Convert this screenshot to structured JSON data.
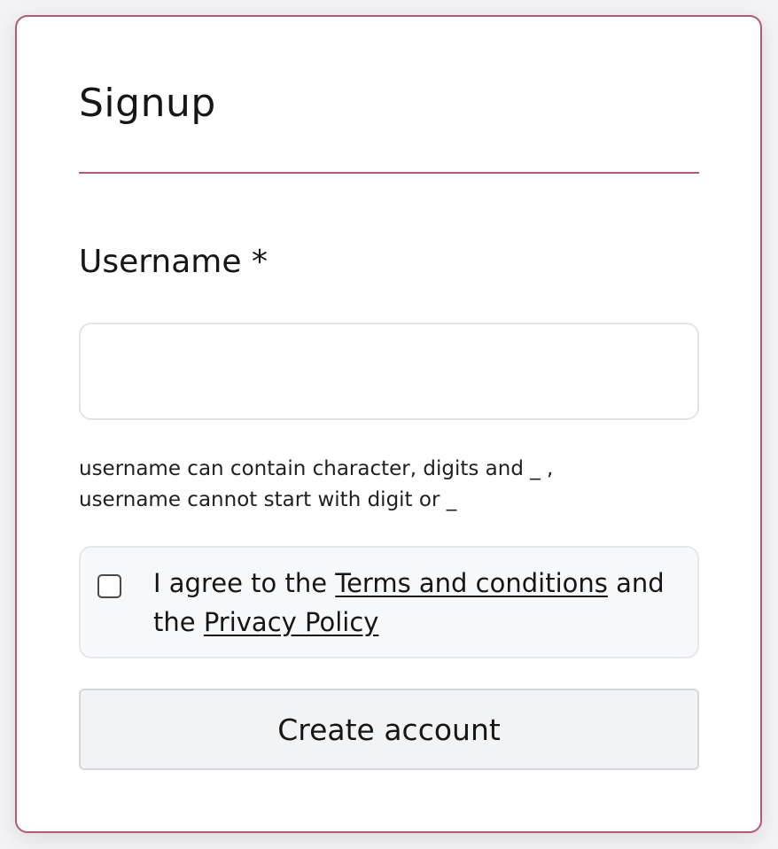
{
  "form": {
    "title": "Signup",
    "username_label": "Username *",
    "username_value": "",
    "username_placeholder": "",
    "helper_line_1": "username can contain character, digits and _ ,",
    "helper_line_2": "username cannot start with digit or _",
    "agree_prefix": "I agree to the ",
    "terms_link": "Terms and conditions",
    "agree_middle": " and the ",
    "privacy_link": "Privacy Policy",
    "agree_checked": false,
    "submit_label": "Create account"
  },
  "colors": {
    "accent_border": "#b05a78",
    "input_border": "#e2e4e8",
    "agree_background": "#f7f8fa",
    "button_background": "#f2f3f5"
  }
}
